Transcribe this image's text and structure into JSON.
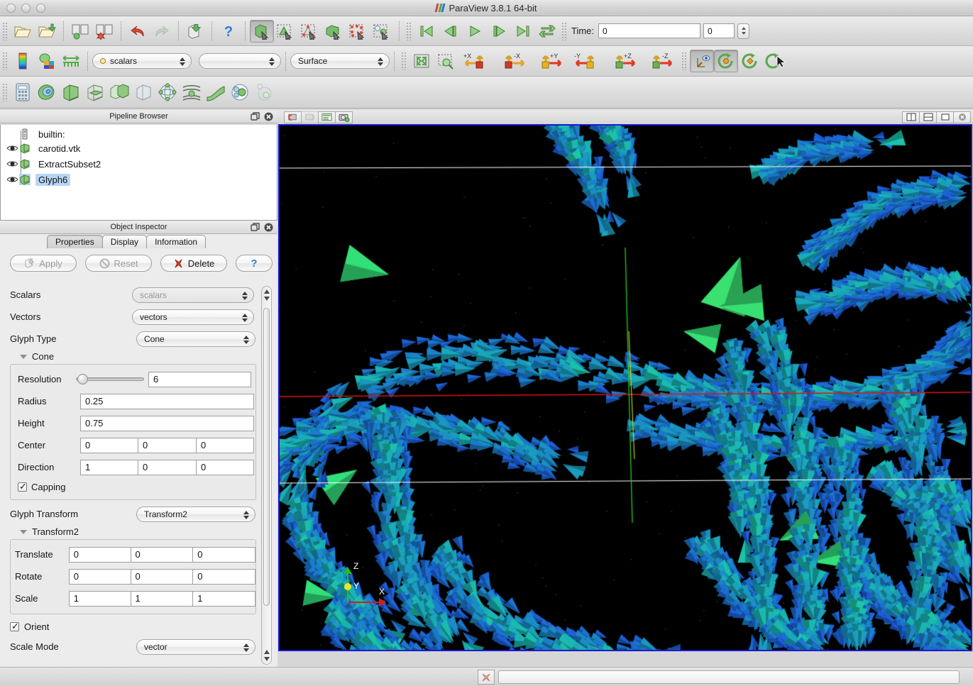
{
  "window": {
    "title": "ParaView 3.8.1 64-bit",
    "logo_colors": [
      "#d04a3a",
      "#4aa84a",
      "#3a6fd0"
    ]
  },
  "toolbar_main": {
    "buttons": [
      {
        "name": "open-file",
        "icon": "open-folder-icon",
        "enabled": true
      },
      {
        "name": "open-recent",
        "icon": "folder-add-icon",
        "enabled": true
      },
      {
        "name": "connect-server",
        "icon": "server-connect-icon",
        "enabled": true
      },
      {
        "name": "disconnect-server",
        "icon": "server-disconnect-icon",
        "enabled": true
      },
      {
        "name": "undo",
        "icon": "undo-arrow-icon",
        "enabled": true
      },
      {
        "name": "redo",
        "icon": "redo-arrow-icon",
        "enabled": false
      },
      {
        "name": "undo-camera",
        "icon": "camera-undo-icon",
        "enabled": true
      },
      {
        "name": "help",
        "icon": "question-mark-icon",
        "enabled": true
      },
      {
        "name": "select-surface-cells",
        "icon": "cube-pointer-icon",
        "enabled": true,
        "pressed": true
      },
      {
        "name": "select-surface-points",
        "icon": "frustum-cells-icon",
        "enabled": true
      },
      {
        "name": "select-points-rubber",
        "icon": "rubber-band-points-icon",
        "enabled": true
      },
      {
        "name": "select-block",
        "icon": "block-select-icon",
        "enabled": true
      },
      {
        "name": "select-frustum-points",
        "icon": "frustum-points-icon",
        "enabled": true
      },
      {
        "name": "interactive-select",
        "icon": "interactive-select-icon",
        "enabled": true
      }
    ],
    "vcr": [
      {
        "name": "first-frame",
        "icon": "skip-back-icon"
      },
      {
        "name": "previous-frame",
        "icon": "step-back-icon"
      },
      {
        "name": "play",
        "icon": "play-icon"
      },
      {
        "name": "next-frame",
        "icon": "step-forward-icon"
      },
      {
        "name": "last-frame",
        "icon": "skip-forward-icon"
      },
      {
        "name": "loop",
        "icon": "loop-icon"
      }
    ],
    "time_label": "Time:",
    "time_value": "0",
    "time_index": "0"
  },
  "toolbar_rep": {
    "color_by_label": "scalars",
    "component_value": "",
    "representation_value": "Surface",
    "buttons": [
      {
        "name": "edit-color-map",
        "icon": "color-legend-icon"
      },
      {
        "name": "rescale-to-data-range",
        "icon": "rescale-colors-icon"
      },
      {
        "name": "rescale-custom-range",
        "icon": "rescale-range-icon"
      },
      {
        "name": "reset-camera",
        "icon": "reset-camera-icon"
      },
      {
        "name": "zoom-to-box",
        "icon": "zoom-box-icon"
      }
    ],
    "camera_buttons": [
      {
        "name": "view-plus-x",
        "label": "+X"
      },
      {
        "name": "view-minus-x",
        "label": "-X"
      },
      {
        "name": "view-plus-y",
        "label": "+Y"
      },
      {
        "name": "view-minus-y",
        "label": "-Y"
      },
      {
        "name": "view-plus-z",
        "label": "+Z"
      },
      {
        "name": "view-minus-z",
        "label": "-Z"
      }
    ],
    "rotate_buttons": [
      {
        "name": "show-center-axes",
        "icon": "center-axes-icon",
        "pressed": true
      },
      {
        "name": "pick-center",
        "icon": "pick-center-icon",
        "pressed": true
      },
      {
        "name": "reset-center",
        "icon": "reset-center-icon"
      },
      {
        "name": "rotate-90-cw",
        "icon": "rotate-cw-icon"
      }
    ]
  },
  "toolbar_filters": {
    "buttons": [
      {
        "name": "calculator-filter",
        "icon": "calculator-icon"
      },
      {
        "name": "contour-filter",
        "icon": "contour-icon"
      },
      {
        "name": "clip-filter",
        "icon": "clip-cube-icon"
      },
      {
        "name": "slice-filter",
        "icon": "slice-cube-icon"
      },
      {
        "name": "threshold-filter",
        "icon": "threshold-icon"
      },
      {
        "name": "extract-subset-filter",
        "icon": "extract-subset-icon"
      },
      {
        "name": "glyph-filter",
        "icon": "glyph-sphere-icon"
      },
      {
        "name": "stream-tracer-filter",
        "icon": "stream-tracer-icon"
      },
      {
        "name": "warp-filter",
        "icon": "warp-icon"
      },
      {
        "name": "group-datasets-filter",
        "icon": "group-datasets-icon"
      },
      {
        "name": "extract-level-filter",
        "icon": "extract-level-icon"
      }
    ]
  },
  "pipeline": {
    "title": "Pipeline Browser",
    "items": [
      {
        "label": "builtin:",
        "icon": "server-icon",
        "has_eye": false,
        "selected": false
      },
      {
        "label": "carotid.vtk",
        "icon": "source-cube-icon",
        "has_eye": true,
        "selected": false
      },
      {
        "label": "ExtractSubset2",
        "icon": "source-cube-icon",
        "has_eye": true,
        "selected": false
      },
      {
        "label": "Glyph6",
        "icon": "source-cube-icon",
        "has_eye": true,
        "selected": true
      }
    ]
  },
  "inspector": {
    "title": "Object Inspector",
    "tabs": [
      {
        "label": "Properties",
        "active": true
      },
      {
        "label": "Display",
        "active": false
      },
      {
        "label": "Information",
        "active": false
      }
    ],
    "actions": [
      {
        "label": "Apply",
        "name": "apply-button",
        "enabled": false,
        "icon": "apply-icon"
      },
      {
        "label": "Reset",
        "name": "reset-button",
        "enabled": false,
        "icon": "reset-icon"
      },
      {
        "label": "Delete",
        "name": "delete-button",
        "enabled": true,
        "icon": "delete-x-icon"
      },
      {
        "label": "?",
        "name": "help-button",
        "enabled": true,
        "icon": "question-mark-icon"
      }
    ],
    "properties": {
      "scalars_label": "Scalars",
      "scalars_value": "scalars",
      "vectors_label": "Vectors",
      "vectors_value": "vectors",
      "glyph_type_label": "Glyph Type",
      "glyph_type_value": "Cone",
      "cone_group_title": "Cone",
      "resolution_label": "Resolution",
      "resolution_value": "6",
      "radius_label": "Radius",
      "radius_value": "0.25",
      "height_label": "Height",
      "height_value": "0.75",
      "center_label": "Center",
      "center_x": "0",
      "center_y": "0",
      "center_z": "0",
      "direction_label": "Direction",
      "direction_x": "1",
      "direction_y": "0",
      "direction_z": "0",
      "capping_label": "Capping",
      "capping_checked": true,
      "glyph_transform_label": "Glyph Transform",
      "glyph_transform_value": "Transform2",
      "transform_group_title": "Transform2",
      "translate_label": "Translate",
      "translate_x": "0",
      "translate_y": "0",
      "translate_z": "0",
      "rotate_label": "Rotate",
      "rotate_x": "0",
      "rotate_y": "0",
      "rotate_z": "0",
      "scale_label": "Scale",
      "scale_x": "1",
      "scale_y": "1",
      "scale_z": "1",
      "orient_label": "Orient",
      "orient_checked": true,
      "scale_mode_label": "Scale Mode",
      "scale_mode_value": "vector"
    }
  },
  "render_view": {
    "toolbar_buttons": [
      {
        "name": "undo-camera-view",
        "icon": "camera-undo-icon",
        "enabled": true
      },
      {
        "name": "redo-camera-view",
        "icon": "camera-redo-icon",
        "enabled": false
      },
      {
        "name": "adjust-camera",
        "icon": "adjust-camera-icon",
        "enabled": true
      },
      {
        "name": "capture-screenshot",
        "icon": "screenshot-icon",
        "enabled": true
      }
    ],
    "layout_buttons": [
      {
        "name": "split-horizontal",
        "icon": "split-horizontal-icon"
      },
      {
        "name": "split-vertical",
        "icon": "split-vertical-icon"
      },
      {
        "name": "maximize-view",
        "icon": "maximize-icon"
      },
      {
        "name": "close-view",
        "icon": "close-view-icon"
      }
    ],
    "axes": {
      "x_label": "X",
      "y_label": "Y",
      "z_label": "Z"
    },
    "background_color": "#000000",
    "border_color": "#1a1ad0",
    "glyph_colors": [
      "#1b3fd0",
      "#1c5fd8",
      "#1b86c8",
      "#19b0b6",
      "#1fd0a0",
      "#2fdf7e",
      "#3fe06a"
    ]
  },
  "status_bar": {
    "cancel_name": "cancel-button",
    "progress_name": "progress-bar"
  }
}
